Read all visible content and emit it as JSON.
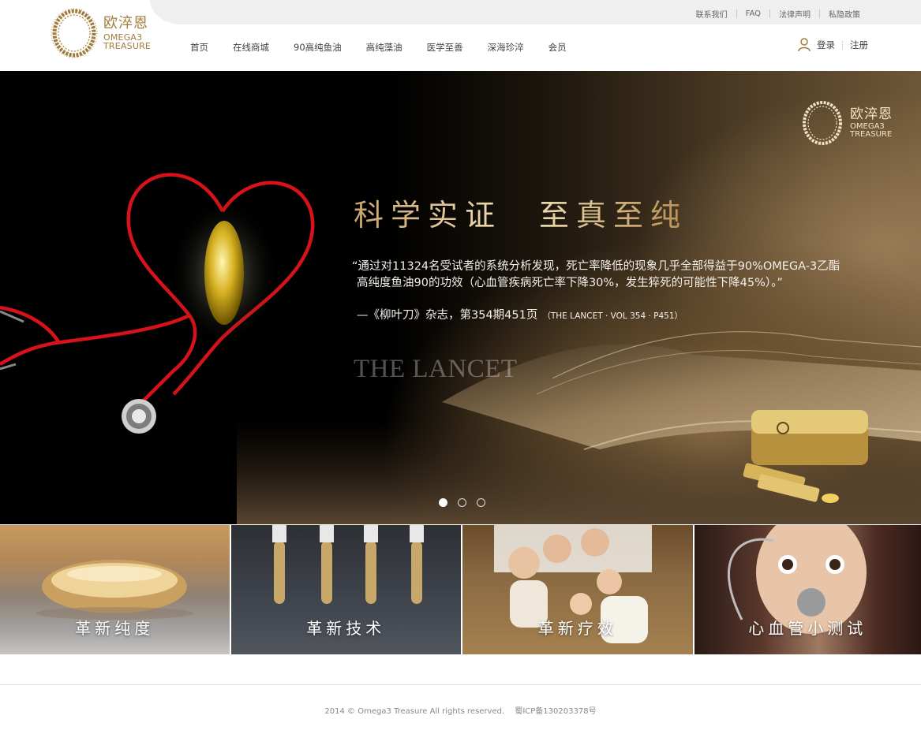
{
  "brand": {
    "name_cn": "欧淬恩",
    "name_en_1": "OMEGA3",
    "name_en_2": "TREASURE",
    "accent_color": "#a07c3c"
  },
  "top_links": [
    "联系我们",
    "FAQ",
    "法律声明",
    "私隐政策"
  ],
  "nav": [
    "首页",
    "在线商城",
    "90高纯鱼油",
    "高纯藻油",
    "医学至善",
    "深海珍淬",
    "会员"
  ],
  "auth": {
    "login": "登录",
    "register": "注册",
    "icon": "user-icon"
  },
  "hero": {
    "headline": "科学实证　至真至纯",
    "quote_line_1": "“通过对11324名受试者的系统分析发现，死亡率降低的现象几乎全部得益于90%OMEGA-3乙酯",
    "quote_line_2": "高纯度鱼油90的功效（心血管疾病死亡率下降30%，发生猝死的可能性下降45%）。”",
    "source": "—《柳叶刀》杂志，第354期451页",
    "source_en": "（THE LANCET · VOL 354 · P451）",
    "journal_watermark": "THE LANCET",
    "slides_total": 3,
    "active_slide": 1
  },
  "tiles": [
    {
      "label": "革新纯度"
    },
    {
      "label": "革新技术"
    },
    {
      "label": "革新疗效"
    },
    {
      "label": "心血管小测试"
    }
  ],
  "footer": {
    "copyright": "2014 © Omega3 Treasure All rights reserved.",
    "icp": "蜀ICP备130203378号"
  }
}
